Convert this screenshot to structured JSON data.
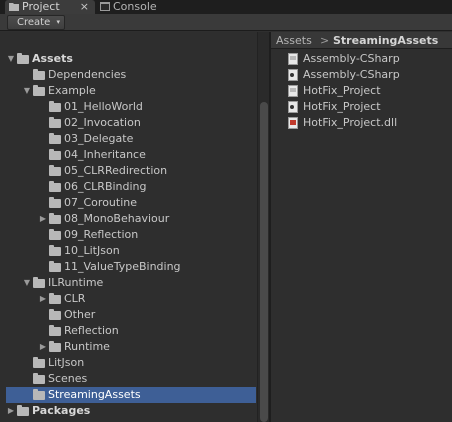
{
  "tabs": [
    {
      "label": "Project",
      "close": "×"
    },
    {
      "label": "Console"
    }
  ],
  "toolbar": {
    "create_label": "Create",
    "create_caret": "▾"
  },
  "tree": [
    {
      "label": "Assets",
      "depth": 0,
      "expanded": true,
      "bold": true
    },
    {
      "label": "Dependencies",
      "depth": 1
    },
    {
      "label": "Example",
      "depth": 1,
      "expanded": true
    },
    {
      "label": "01_HelloWorld",
      "depth": 2
    },
    {
      "label": "02_Invocation",
      "depth": 2
    },
    {
      "label": "03_Delegate",
      "depth": 2
    },
    {
      "label": "04_Inheritance",
      "depth": 2
    },
    {
      "label": "05_CLRRedirection",
      "depth": 2
    },
    {
      "label": "06_CLRBinding",
      "depth": 2
    },
    {
      "label": "07_Coroutine",
      "depth": 2
    },
    {
      "label": "08_MonoBehaviour",
      "depth": 2,
      "collapsed": true
    },
    {
      "label": "09_Reflection",
      "depth": 2
    },
    {
      "label": "10_LitJson",
      "depth": 2
    },
    {
      "label": "11_ValueTypeBinding",
      "depth": 2
    },
    {
      "label": "ILRuntime",
      "depth": 1,
      "expanded": true
    },
    {
      "label": "CLR",
      "depth": 2,
      "collapsed": true
    },
    {
      "label": "Other",
      "depth": 2
    },
    {
      "label": "Reflection",
      "depth": 2
    },
    {
      "label": "Runtime",
      "depth": 2,
      "collapsed": true
    },
    {
      "label": "LitJson",
      "depth": 1
    },
    {
      "label": "Scenes",
      "depth": 1
    },
    {
      "label": "StreamingAssets",
      "depth": 1,
      "selected": true
    },
    {
      "label": "Packages",
      "depth": 0,
      "collapsed": true,
      "bold": true
    }
  ],
  "breadcrumb": {
    "root": "Assets",
    "separator": ">",
    "current": "StreamingAssets"
  },
  "files": [
    {
      "label": "Assembly-CSharp",
      "icon": "file-text-icon"
    },
    {
      "label": "Assembly-CSharp",
      "icon": "file-pdb-icon"
    },
    {
      "label": "HotFix_Project",
      "icon": "file-text-icon"
    },
    {
      "label": "HotFix_Project",
      "icon": "file-pdb-icon"
    },
    {
      "label": "HotFix_Project.dll",
      "icon": "file-dll-icon"
    }
  ],
  "colors": {
    "selection": "#3e5f96",
    "panel": "#2e2e2e",
    "accent_dll": "#c0392b"
  }
}
